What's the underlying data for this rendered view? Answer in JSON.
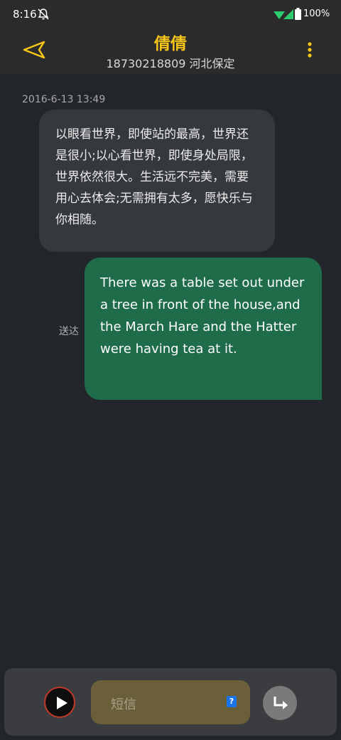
{
  "status_bar": {
    "time": "8:16",
    "battery": "100%",
    "icons": [
      "bell-off-icon",
      "wifi-icon",
      "signal-icon",
      "battery-icon"
    ]
  },
  "header": {
    "contact_name": "倩倩",
    "contact_sub": "18730218809 河北保定",
    "icons": [
      "back-arrow-icon",
      "more-vert-icon"
    ],
    "accent_color": "#f5c518"
  },
  "messages": {
    "timestamp": "2016-6-13 13:49",
    "incoming_text": "以眼看世界，即使站的最高，世界还是很小;以心看世界，即使身处局限，世界依然很大。生活远不完美，需要用心去体会;无需拥有太多，愿快乐与你相随。",
    "outgoing_text": "There was a table set out under a tree in front of the house,and the March Hare and the Hatter were having tea at it.",
    "outgoing_status": "送达",
    "outgoing_bubble_color": "#1e6c4a"
  },
  "compose": {
    "placeholder": "短信",
    "sim_badge": "?",
    "icons": [
      "play-icon",
      "send-icon"
    ]
  }
}
